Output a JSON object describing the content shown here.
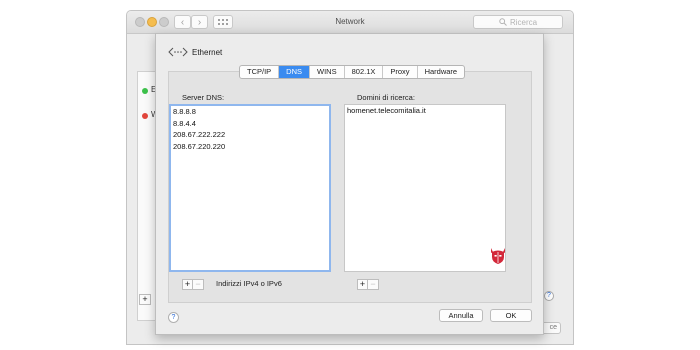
{
  "window": {
    "title": "Network",
    "search_placeholder": "Ricerca"
  },
  "sheet": {
    "interface_name": "Ethernet",
    "tabs": [
      "TCP/IP",
      "DNS",
      "WINS",
      "802.1X",
      "Proxy",
      "Hardware"
    ],
    "active_tab": "DNS",
    "dns_label": "Server DNS:",
    "dns_servers": [
      "8.8.8.8",
      "8.8.4.4",
      "208.67.222.222",
      "208.67.220.220"
    ],
    "search_domains_label": "Domini di ricerca:",
    "search_domains": [
      "homenet.telecomitalia.it"
    ],
    "hint": "Indirizzi IPv4 o IPv6",
    "add_label": "+",
    "remove_label": "−",
    "help_label": "?",
    "cancel_label": "Annulla",
    "ok_label": "OK"
  },
  "background": {
    "services": [
      {
        "letter": "E",
        "status_color": "#3cc14a"
      },
      {
        "letter": "W",
        "status_color": "#e2463c"
      }
    ],
    "add_label": "+",
    "help_label": "?",
    "partial_button_text": "ce"
  },
  "colors": {
    "accent": "#3a8bf0",
    "logo": "#d3283a"
  }
}
